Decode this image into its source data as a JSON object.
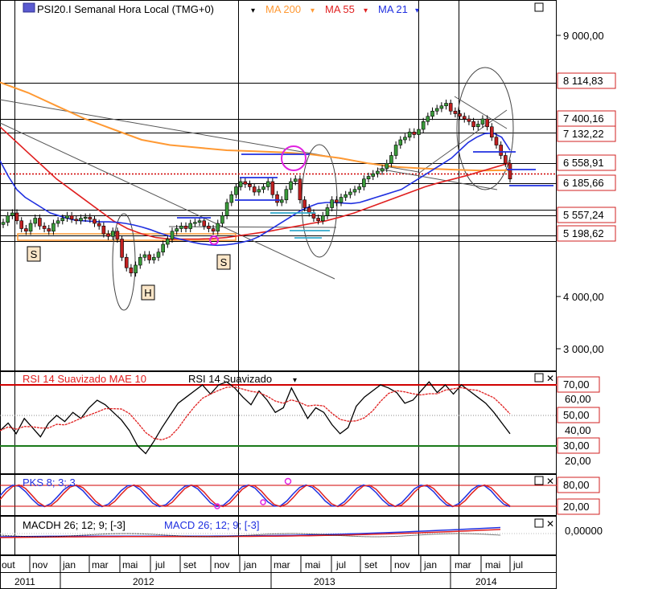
{
  "header": {
    "title": "PSI20.I Semanal Hora Local (TMG+0)",
    "dropdown_glyph": "▾",
    "indicators": [
      {
        "label": "MA 200",
        "color": "#ff9933"
      },
      {
        "label": "MA 55",
        "color": "#e02020"
      },
      {
        "label": "MA 21",
        "color": "#2030e0"
      }
    ]
  },
  "price_axis": {
    "ticks": [
      {
        "label": "9 000,00",
        "value": 9000
      },
      {
        "label": "4 000,00",
        "value": 4000
      },
      {
        "label": "3 000,00",
        "value": 3000
      }
    ],
    "boxed_labels": [
      {
        "label": "8 114,83",
        "value": 8115
      },
      {
        "label": "7 400,16",
        "value": 7400
      },
      {
        "label": "7 132,22",
        "value": 7132
      },
      {
        "label": "6 558,91",
        "value": 6559
      },
      {
        "label": "6 185,66",
        "value": 6186
      },
      {
        "label": "5 557,24",
        "value": 5557
      },
      {
        "label": "5 198,62",
        "value": 5199
      }
    ]
  },
  "pattern_labels": [
    "S",
    "H",
    "S"
  ],
  "rsi_panel": {
    "legend1": "RSI 14 Suavizado MAE 10",
    "legend2": "RSI 14 Suavizado",
    "ticks": [
      "60,00",
      "40,00",
      "20,00"
    ],
    "boxed": [
      "70,00",
      "50,00",
      "30,00"
    ]
  },
  "pks_panel": {
    "legend": "PKS 8; 3; 3",
    "boxed": [
      "80,00",
      "20,00"
    ]
  },
  "macd_panel": {
    "legend1": "MACDH 26; 12; 9; [-3]",
    "legend2": "MACD 26; 12; 9; [-3]",
    "tick": "0,00000"
  },
  "time_axis": {
    "months": [
      "out",
      "nov",
      "jan",
      "mar",
      "mai",
      "jul",
      "set",
      "nov",
      "jan",
      "mar",
      "mai",
      "jul",
      "set",
      "nov",
      "jan",
      "mar",
      "mai",
      "jul"
    ],
    "years": [
      "2011",
      "2012",
      "2013",
      "2014"
    ]
  },
  "controls": {
    "close_glyph": "✕",
    "pane_glyph": "□"
  },
  "colors": {
    "up": "#3a9a3a",
    "down": "#c02020",
    "ma200": "#ff9933",
    "ma55": "#e02020",
    "ma21": "#2030e0"
  },
  "chart_data": {
    "type": "candlestick",
    "title": "PSI20.I Semanal Hora Local (TMG+0)",
    "x_start": "2011-10",
    "x_end": "2014-06",
    "ylim": [
      2500,
      9600
    ],
    "price_close": [
      5420,
      5550,
      5600,
      5450,
      5300,
      5250,
      5400,
      5500,
      5350,
      5300,
      5250,
      5400,
      5450,
      5500,
      5550,
      5480,
      5450,
      5500,
      5520,
      5480,
      5400,
      5350,
      5200,
      5150,
      5250,
      5100,
      4750,
      4550,
      4450,
      4600,
      4750,
      4800,
      4700,
      4750,
      4850,
      5000,
      5100,
      5250,
      5300,
      5350,
      5300,
      5400,
      5420,
      5450,
      5350,
      5300,
      5250,
      5400,
      5550,
      5800,
      5950,
      6100,
      6200,
      6150,
      6100,
      6000,
      6050,
      6100,
      6200,
      5950,
      5800,
      5850,
      6050,
      6200,
      6250,
      5850,
      5700,
      5600,
      5500,
      5450,
      5550,
      5700,
      5850,
      5800,
      5900,
      5950,
      6000,
      6050,
      6100,
      6250,
      6300,
      6350,
      6400,
      6450,
      6550,
      6700,
      6900,
      7000,
      7050,
      7150,
      7100,
      7200,
      7350,
      7450,
      7550,
      7600,
      7650,
      7700,
      7550,
      7500,
      7450,
      7400,
      7350,
      7250,
      7300,
      7400,
      7250,
      7050,
      6900,
      6700,
      6550,
      6250
    ],
    "ma21": [
      6600,
      6300,
      6050,
      5900,
      5800,
      5700,
      5600,
      5550,
      5500,
      5460,
      5450,
      5440,
      5430,
      5430,
      5420,
      5400,
      5370,
      5330,
      5280,
      5220,
      5170,
      5120,
      5080,
      5040,
      5010,
      4990,
      4980,
      4990,
      5010,
      5040,
      5080,
      5150,
      5250,
      5350,
      5450,
      5550,
      5650,
      5720,
      5780,
      5800,
      5800,
      5790,
      5780,
      5800,
      5850,
      5900,
      5950,
      6000,
      6050,
      6150,
      6250,
      6350,
      6450,
      6550,
      6650,
      6800,
      6950,
      7050,
      7120,
      7130,
      7050,
      6800
    ],
    "ma55": [
      7250,
      7000,
      6750,
      6500,
      6250,
      6050,
      5850,
      5650,
      5450,
      5300,
      5200,
      5130,
      5100,
      5100,
      5100,
      5110,
      5130,
      5170,
      5210,
      5250,
      5300,
      5350,
      5400,
      5450,
      5520,
      5600,
      5700,
      5800,
      5900,
      6000,
      6100,
      6180,
      6250,
      6320,
      6400,
      6480,
      6560
    ],
    "ma200": [
      8100,
      7900,
      7650,
      7400,
      7200,
      7000,
      6900,
      6850,
      6800,
      6780,
      6760,
      6720,
      6650,
      6550,
      6480,
      6450,
      6430,
      6410,
      6420
    ]
  }
}
